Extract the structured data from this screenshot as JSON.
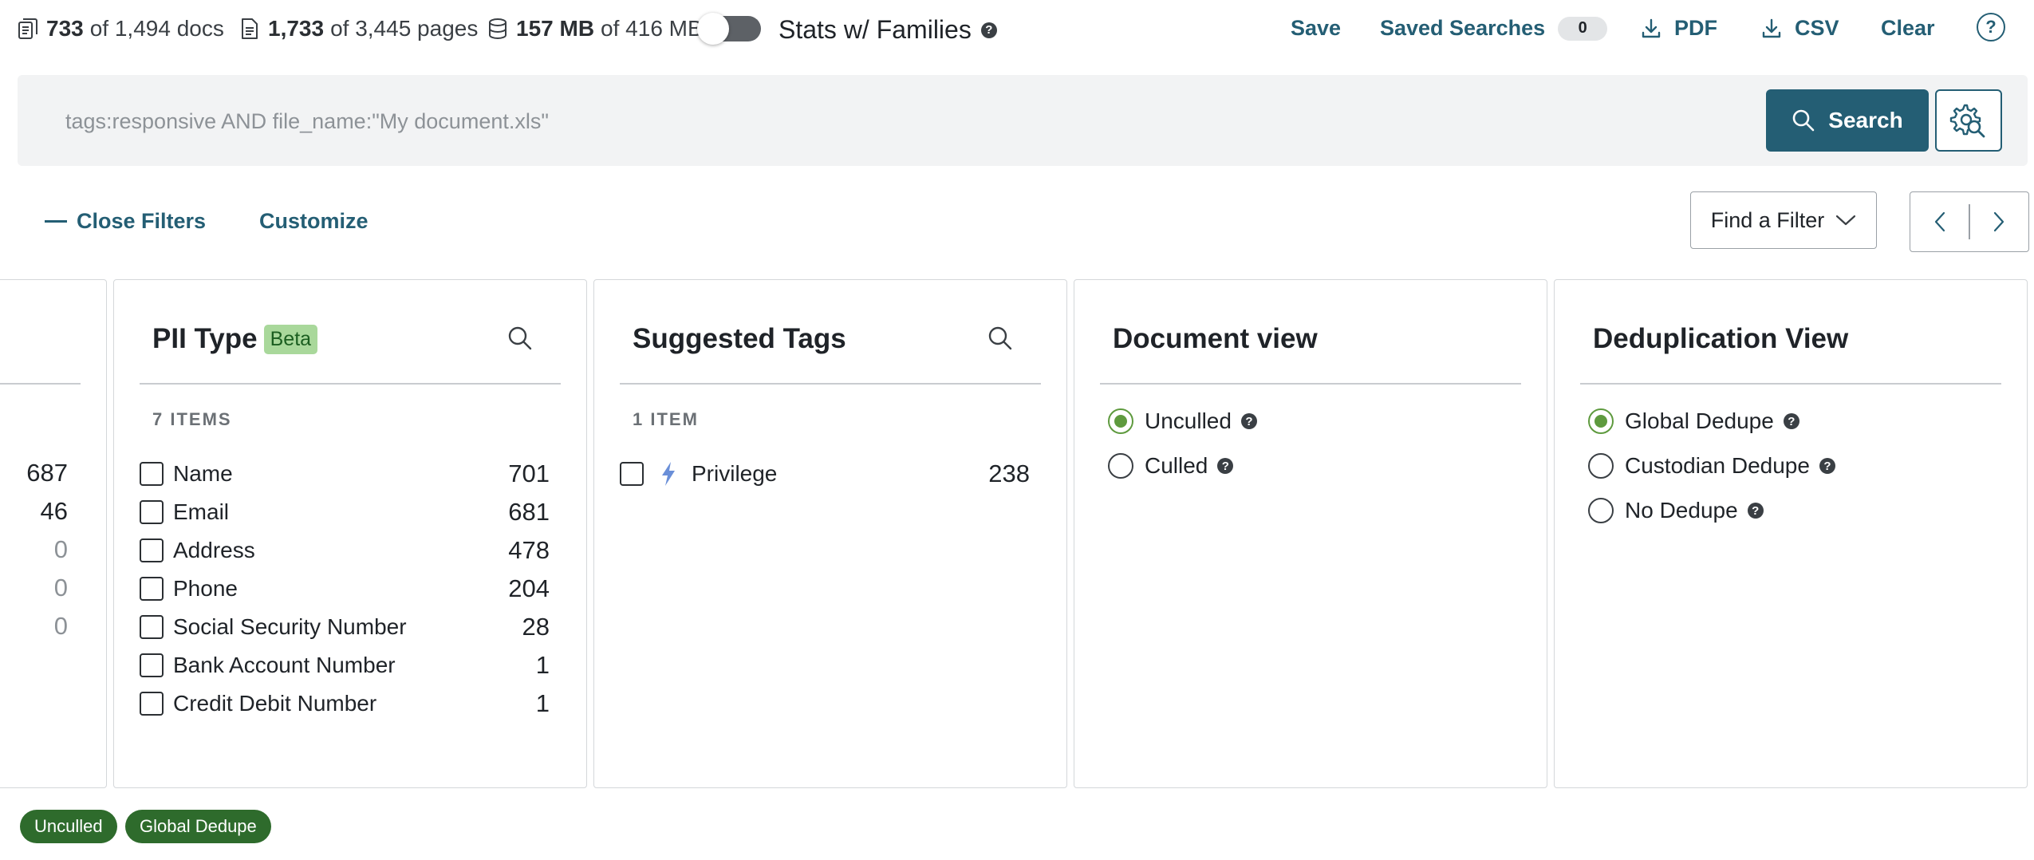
{
  "stats": {
    "docs": {
      "count": "733",
      "rest": "of 1,494 docs"
    },
    "pages": {
      "count": "1,733",
      "rest": "of 3,445 pages"
    },
    "size": {
      "count": "157 MB",
      "rest": "of 416 MB"
    },
    "families_toggle": {
      "label": "Stats w/ Families",
      "on": false
    }
  },
  "top_actions": {
    "save": "Save",
    "saved_searches": "Saved Searches",
    "saved_searches_count": "0",
    "pdf": "PDF",
    "csv": "CSV",
    "clear": "Clear",
    "help": "?"
  },
  "search": {
    "placeholder": "tags:responsive AND file_name:\"My document.xls\"",
    "button_label": "Search"
  },
  "filter_controls": {
    "close_filters": "Close Filters",
    "customize": "Customize",
    "find_filter": "Find a Filter"
  },
  "partial_panel": {
    "values": [
      "687",
      "46",
      "0",
      "0",
      "0"
    ]
  },
  "pii_panel": {
    "title": "PII Type",
    "badge": "Beta",
    "items_count": "7 ITEMS",
    "items": [
      {
        "label": "Name",
        "count": "701"
      },
      {
        "label": "Email",
        "count": "681"
      },
      {
        "label": "Address",
        "count": "478"
      },
      {
        "label": "Phone",
        "count": "204"
      },
      {
        "label": "Social Security Number",
        "count": "28"
      },
      {
        "label": "Bank Account Number",
        "count": "1"
      },
      {
        "label": "Credit Debit Number",
        "count": "1"
      }
    ]
  },
  "tags_panel": {
    "title": "Suggested Tags",
    "items_count": "1 ITEM",
    "items": [
      {
        "label": "Privilege",
        "count": "238"
      }
    ]
  },
  "docview_panel": {
    "title": "Document view",
    "options": [
      {
        "label": "Unculled",
        "selected": true
      },
      {
        "label": "Culled",
        "selected": false
      }
    ]
  },
  "dedupe_panel": {
    "title": "Deduplication View",
    "options": [
      {
        "label": "Global Dedupe",
        "selected": true
      },
      {
        "label": "Custodian Dedupe",
        "selected": false
      },
      {
        "label": "No Dedupe",
        "selected": false
      }
    ]
  },
  "applied_filters": [
    "Unculled",
    "Global Dedupe"
  ],
  "colors": {
    "accent": "#245e74",
    "radio_selected": "#5e9a3e",
    "chip_bg": "#2e6b2c",
    "beta_bg": "#a9d89b"
  }
}
